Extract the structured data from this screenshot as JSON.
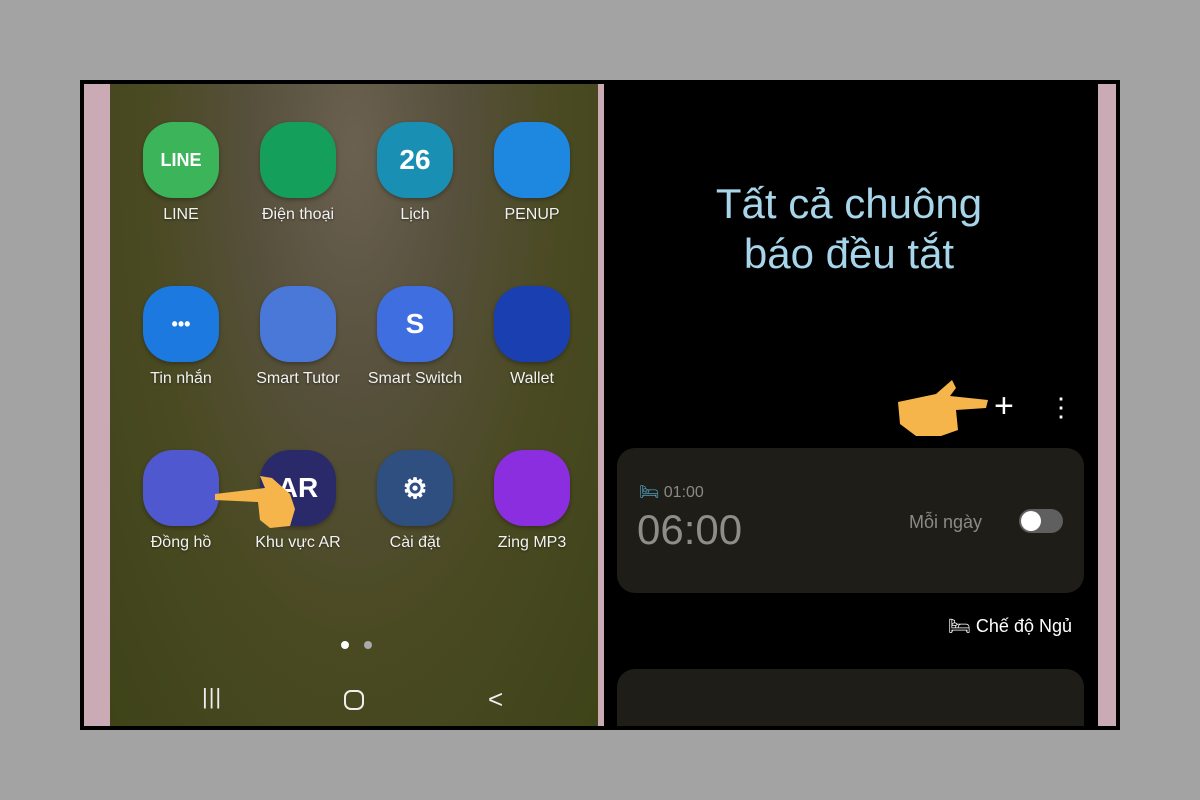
{
  "home": {
    "apps": [
      {
        "label": "LINE",
        "icon": "line-icon",
        "color": "#3cb55a",
        "glyph": "LINE"
      },
      {
        "label": "Điện thoại",
        "icon": "phone-icon",
        "color": "#14a05a",
        "glyph": ""
      },
      {
        "label": "Lịch",
        "icon": "calendar-icon",
        "color": "#1a8fb4",
        "glyph": "26"
      },
      {
        "label": "PENUP",
        "icon": "penup-icon",
        "color": "#1e88e0",
        "glyph": ""
      },
      {
        "label": "Tin nhắn",
        "icon": "messages-icon",
        "color": "#1b79e0",
        "glyph": "•••"
      },
      {
        "label": "Smart Tutor",
        "icon": "headset-icon",
        "color": "#4a78d8",
        "glyph": ""
      },
      {
        "label": "Smart Switch",
        "icon": "smart-switch-icon",
        "color": "#3f6ee0",
        "glyph": "S"
      },
      {
        "label": "Wallet",
        "icon": "wallet-icon",
        "color": "#1a3fb0",
        "glyph": ""
      },
      {
        "label": "Đồng hồ",
        "icon": "clock-icon",
        "color": "#5058d0",
        "glyph": ""
      },
      {
        "label": "Khu vực AR",
        "icon": "ar-icon",
        "color": "#2a2a6a",
        "glyph": "AR"
      },
      {
        "label": "Cài đặt",
        "icon": "settings-icon",
        "color": "#2f4f80",
        "glyph": "⚙"
      },
      {
        "label": "Zing MP3",
        "icon": "zing-mp3-icon",
        "color": "#8a2ee0",
        "glyph": ""
      }
    ],
    "page_indicator": {
      "current": 1,
      "total": 2
    }
  },
  "alarm": {
    "header": "Tất cả chuông báo đều tắt",
    "add_label": "+",
    "more_label": "⋮",
    "items": [
      {
        "bedtime": "01:00",
        "time": "06:00",
        "repeat": "Mỗi ngày",
        "enabled": false
      }
    ],
    "sleep_mode": "Chế độ Ngủ"
  }
}
